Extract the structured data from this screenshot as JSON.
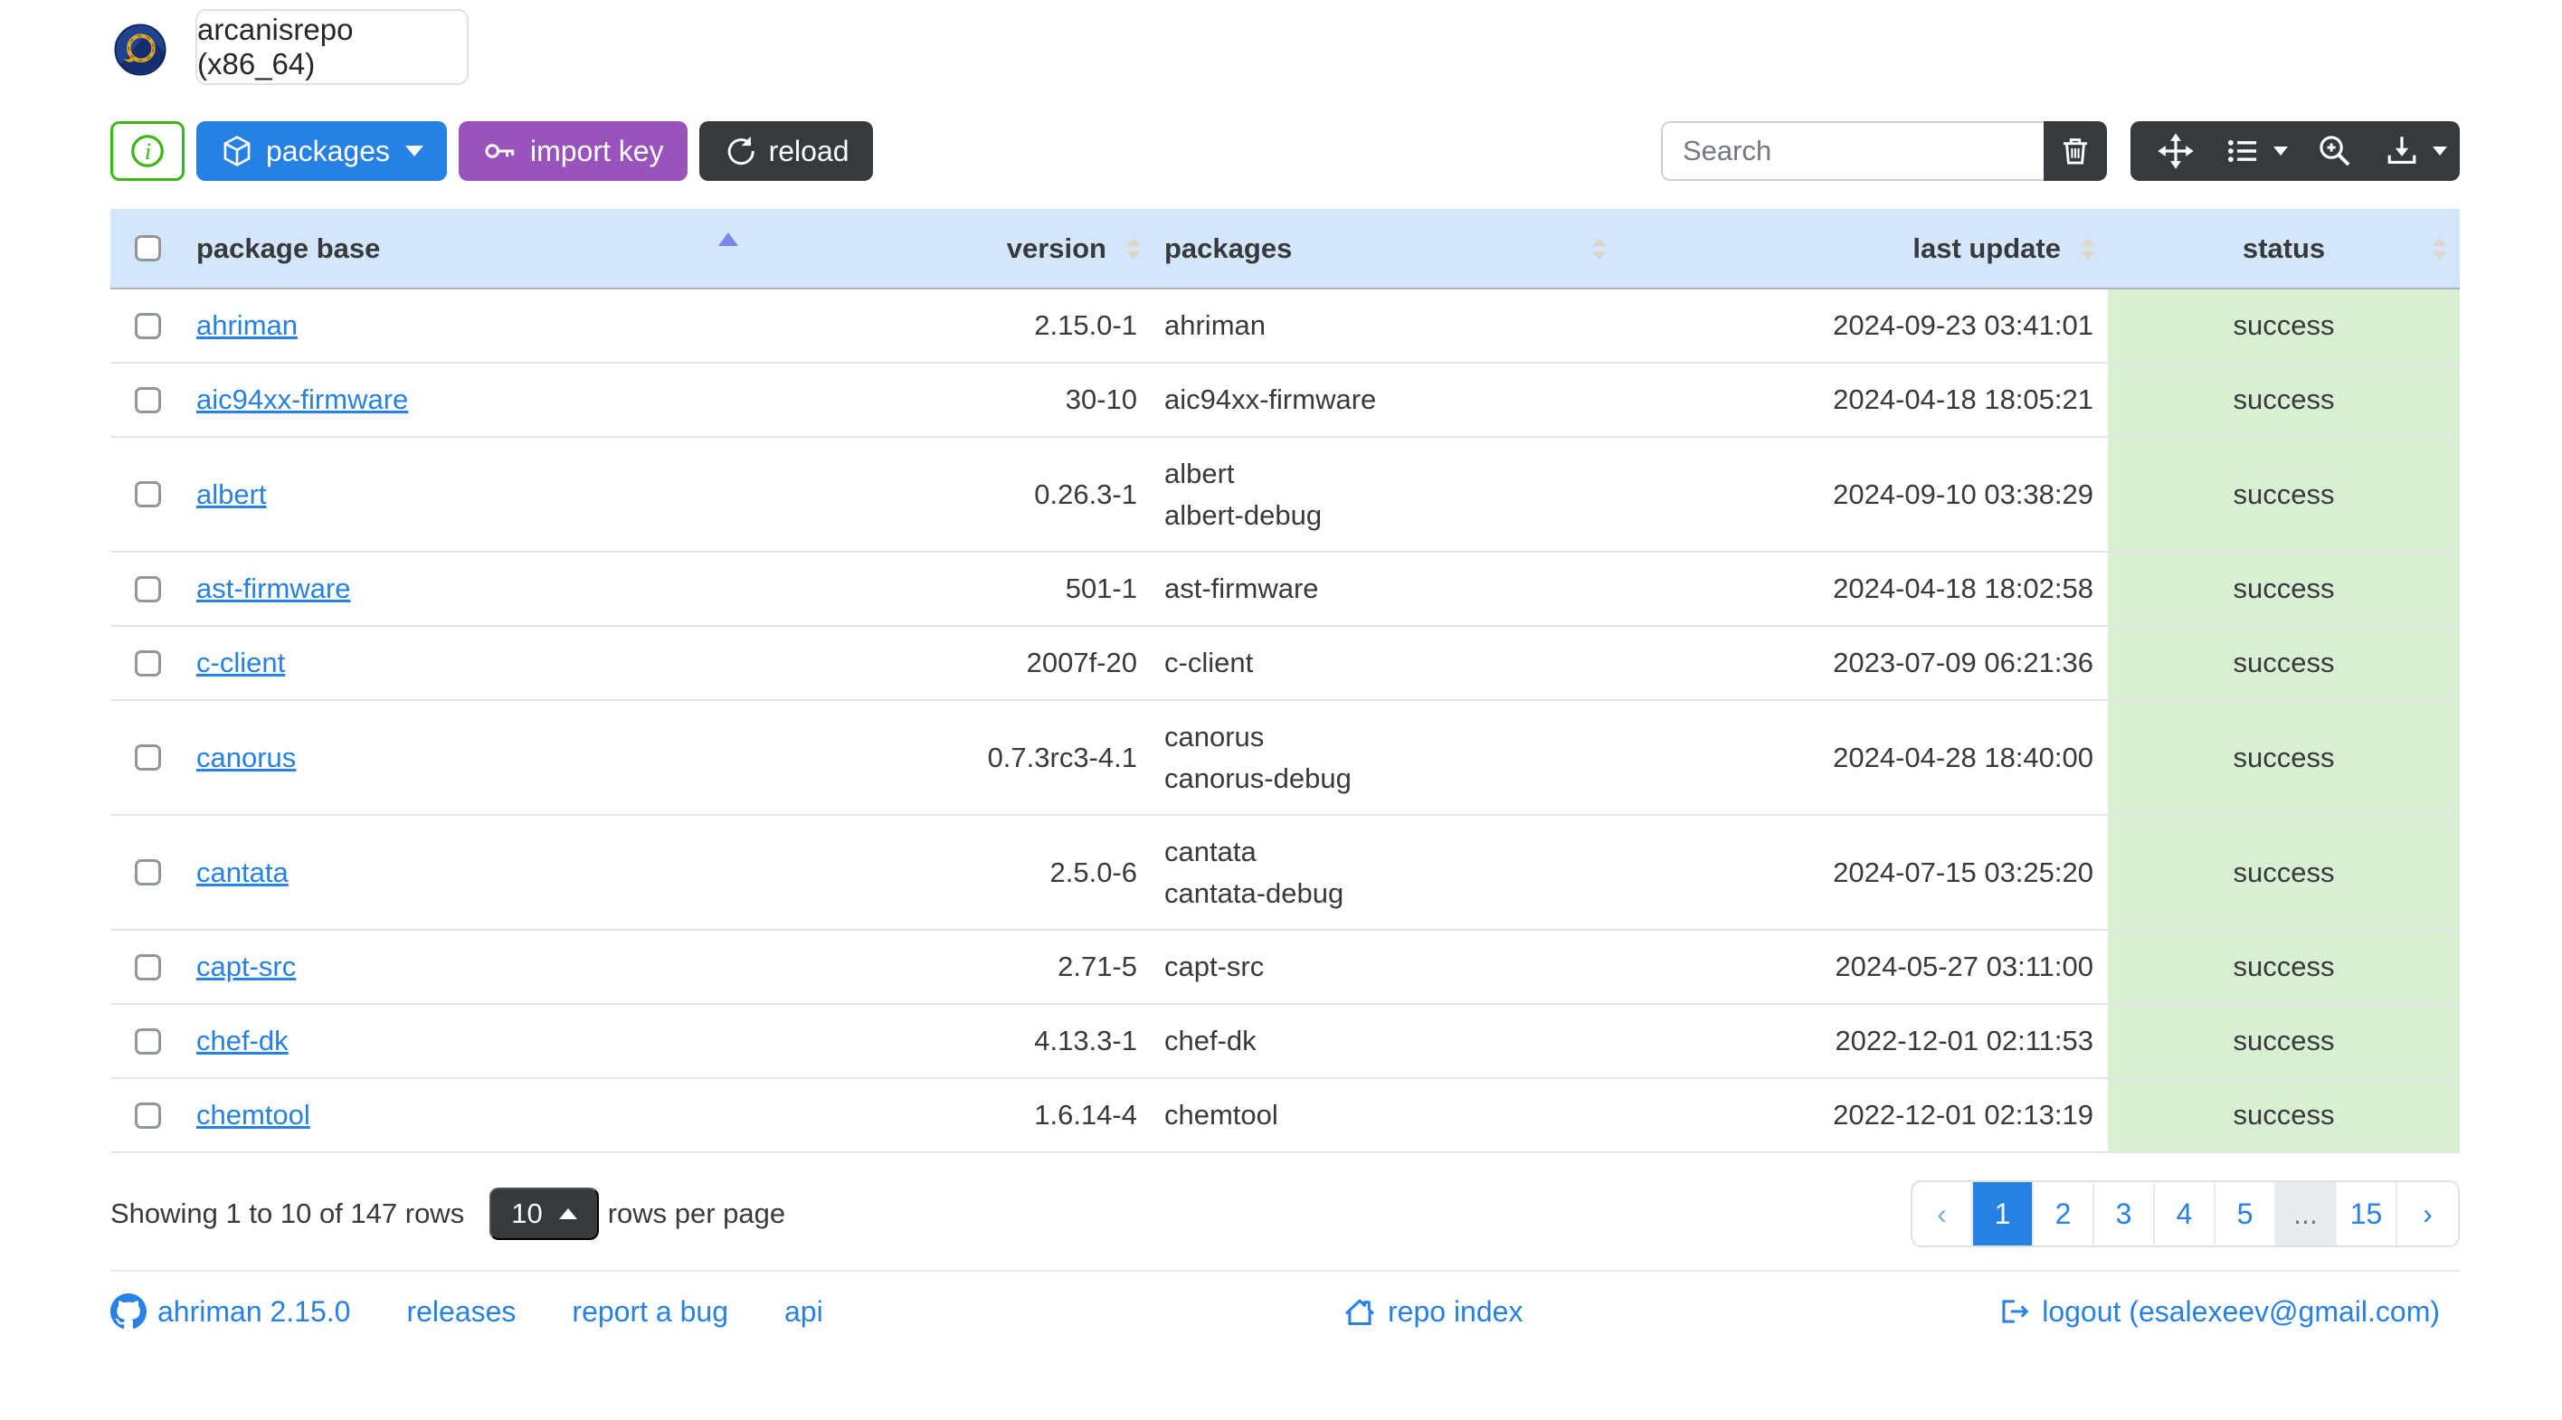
{
  "window": {
    "tab_title": "arcanisrepo (x86_64)"
  },
  "toolbar": {
    "packages_label": "packages",
    "import_key_label": "import key",
    "reload_label": "reload",
    "search_placeholder": "Search",
    "icons": [
      "info-circle-icon",
      "box-icon",
      "key-icon",
      "arrow-clockwise-icon",
      "trash-icon",
      "arrows-move-icon",
      "list-columns-icon",
      "zoom-in-icon",
      "download-icon"
    ]
  },
  "table": {
    "columns": [
      {
        "label": "package base",
        "sort": "asc"
      },
      {
        "label": "version",
        "align": "right"
      },
      {
        "label": "packages",
        "align": "left"
      },
      {
        "label": "last update",
        "align": "right"
      },
      {
        "label": "status",
        "align": "center"
      }
    ],
    "rows": [
      {
        "base": "ahriman",
        "version": "2.15.0-1",
        "packages": [
          "ahriman"
        ],
        "last_update": "2024-09-23 03:41:01",
        "status": "success"
      },
      {
        "base": "aic94xx-firmware",
        "version": "30-10",
        "packages": [
          "aic94xx-firmware"
        ],
        "last_update": "2024-04-18 18:05:21",
        "status": "success"
      },
      {
        "base": "albert",
        "version": "0.26.3-1",
        "packages": [
          "albert",
          "albert-debug"
        ],
        "last_update": "2024-09-10 03:38:29",
        "status": "success"
      },
      {
        "base": "ast-firmware",
        "version": "501-1",
        "packages": [
          "ast-firmware"
        ],
        "last_update": "2024-04-18 18:02:58",
        "status": "success"
      },
      {
        "base": "c-client",
        "version": "2007f-20",
        "packages": [
          "c-client"
        ],
        "last_update": "2023-07-09 06:21:36",
        "status": "success"
      },
      {
        "base": "canorus",
        "version": "0.7.3rc3-4.1",
        "packages": [
          "canorus",
          "canorus-debug"
        ],
        "last_update": "2024-04-28 18:40:00",
        "status": "success"
      },
      {
        "base": "cantata",
        "version": "2.5.0-6",
        "packages": [
          "cantata",
          "cantata-debug"
        ],
        "last_update": "2024-07-15 03:25:20",
        "status": "success"
      },
      {
        "base": "capt-src",
        "version": "2.71-5",
        "packages": [
          "capt-src"
        ],
        "last_update": "2024-05-27 03:11:00",
        "status": "success"
      },
      {
        "base": "chef-dk",
        "version": "4.13.3-1",
        "packages": [
          "chef-dk"
        ],
        "last_update": "2022-12-01 02:11:53",
        "status": "success"
      },
      {
        "base": "chemtool",
        "version": "1.6.14-4",
        "packages": [
          "chemtool"
        ],
        "last_update": "2022-12-01 02:13:19",
        "status": "success"
      }
    ]
  },
  "footer": {
    "showing_text": "Showing 1 to 10 of 147 rows",
    "page_size": "10",
    "rows_per_page_text": "rows per page",
    "pagination": [
      {
        "label": "‹",
        "state": "prev"
      },
      {
        "label": "1",
        "state": "active"
      },
      {
        "label": "2",
        "state": ""
      },
      {
        "label": "3",
        "state": ""
      },
      {
        "label": "4",
        "state": ""
      },
      {
        "label": "5",
        "state": ""
      },
      {
        "label": "...",
        "state": "disabled"
      },
      {
        "label": "15",
        "state": ""
      },
      {
        "label": "›",
        "state": ""
      }
    ]
  },
  "links": {
    "version": "ahriman 2.15.0",
    "releases": "releases",
    "report_bug": "report a bug",
    "api": "api",
    "repo_index": "repo index",
    "logout": "logout (esalexeev@gmail.com)"
  },
  "colors": {
    "primary": "#2780e3",
    "purple": "#9954bb",
    "green": "#3fb618",
    "dark": "#373a3c",
    "header-bg": "#d4e6f9",
    "success-bg": "#d9efd1",
    "text": "#373a3c"
  }
}
